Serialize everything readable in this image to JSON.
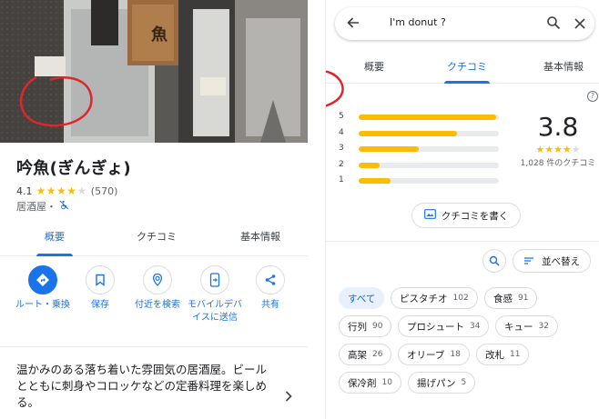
{
  "place": {
    "name": "吟魚(ぎんぎょ)",
    "rating": "4.1",
    "rating_count": "(570)",
    "rating_stars": 4,
    "category": "居酒屋・",
    "category_icon": "no-wheelchair-icon",
    "description": "温かみのある落ち着いた雰囲気の居酒屋。ビールとともに刺身やコロッケなどの定番料理を楽しめる。",
    "photo_sign_text": "魚"
  },
  "left_tabs": [
    {
      "label": "概要",
      "active": true
    },
    {
      "label": "クチコミ",
      "active": false
    },
    {
      "label": "基本情報",
      "active": false
    }
  ],
  "actions": [
    {
      "label": "ルート・乗換",
      "icon": "directions-icon"
    },
    {
      "label": "保存",
      "icon": "bookmark-icon"
    },
    {
      "label": "付近を検索",
      "icon": "nearby-icon"
    },
    {
      "label": "モバイルデバイスに送信",
      "icon": "send-to-phone-icon"
    },
    {
      "label": "共有",
      "icon": "share-icon"
    }
  ],
  "search": {
    "query": "I'm donut ?"
  },
  "right_tabs": [
    {
      "label": "概要",
      "active": false
    },
    {
      "label": "クチコミ",
      "active": true
    },
    {
      "label": "基本情報",
      "active": false
    }
  ],
  "reviews": {
    "score": "3.8",
    "score_stars": 4,
    "count_text": "1,028 件のクチコミ",
    "histogram": [
      {
        "star": "5",
        "fraction": 0.98
      },
      {
        "star": "4",
        "fraction": 0.7
      },
      {
        "star": "3",
        "fraction": 0.43
      },
      {
        "star": "2",
        "fraction": 0.15
      },
      {
        "star": "1",
        "fraction": 0.23
      }
    ],
    "write_label": "クチコミを書く",
    "sort_label": "並べ替え"
  },
  "chips": [
    {
      "label": "すべて",
      "count": "",
      "selected": true
    },
    {
      "label": "ピスタチオ",
      "count": "102",
      "selected": false
    },
    {
      "label": "食感",
      "count": "91",
      "selected": false
    },
    {
      "label": "行列",
      "count": "90",
      "selected": false
    },
    {
      "label": "プロシュート",
      "count": "34",
      "selected": false
    },
    {
      "label": "キュー",
      "count": "32",
      "selected": false
    },
    {
      "label": "高架",
      "count": "26",
      "selected": false
    },
    {
      "label": "オリーブ",
      "count": "18",
      "selected": false
    },
    {
      "label": "改札",
      "count": "11",
      "selected": false
    },
    {
      "label": "保冷剤",
      "count": "10",
      "selected": false
    },
    {
      "label": "揚げパン",
      "count": "5",
      "selected": false
    }
  ],
  "colors": {
    "accent": "#1a73e8",
    "star": "#fbbc04",
    "chip_selected_bg": "#e8f0fe",
    "annotation_red": "#e0262a"
  }
}
